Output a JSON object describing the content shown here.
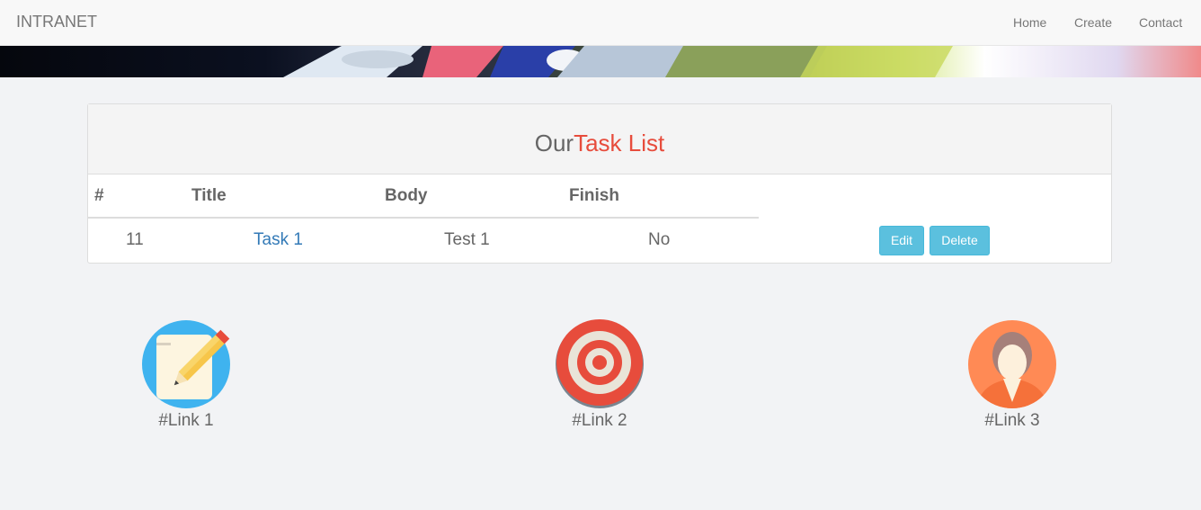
{
  "navbar": {
    "brand": "INTRANET",
    "links": [
      "Home",
      "Create",
      "Contact"
    ]
  },
  "panel": {
    "title_prefix": "Our",
    "title_highlight": "Task List",
    "columns": [
      "#",
      "Title",
      "Body",
      "Finish"
    ],
    "rows": [
      {
        "id": "11",
        "title": "Task 1",
        "body": "Test 1",
        "finish": "No",
        "edit_label": "Edit",
        "delete_label": "Delete"
      }
    ]
  },
  "features": [
    {
      "label": "#Link 1",
      "icon": "pencil-note-icon"
    },
    {
      "label": "#Link 2",
      "icon": "target-icon"
    },
    {
      "label": "#Link 3",
      "icon": "user-avatar-icon"
    }
  ],
  "colors": {
    "accent": "#e74c3c",
    "button": "#5bc0de",
    "link": "#337ab7"
  }
}
